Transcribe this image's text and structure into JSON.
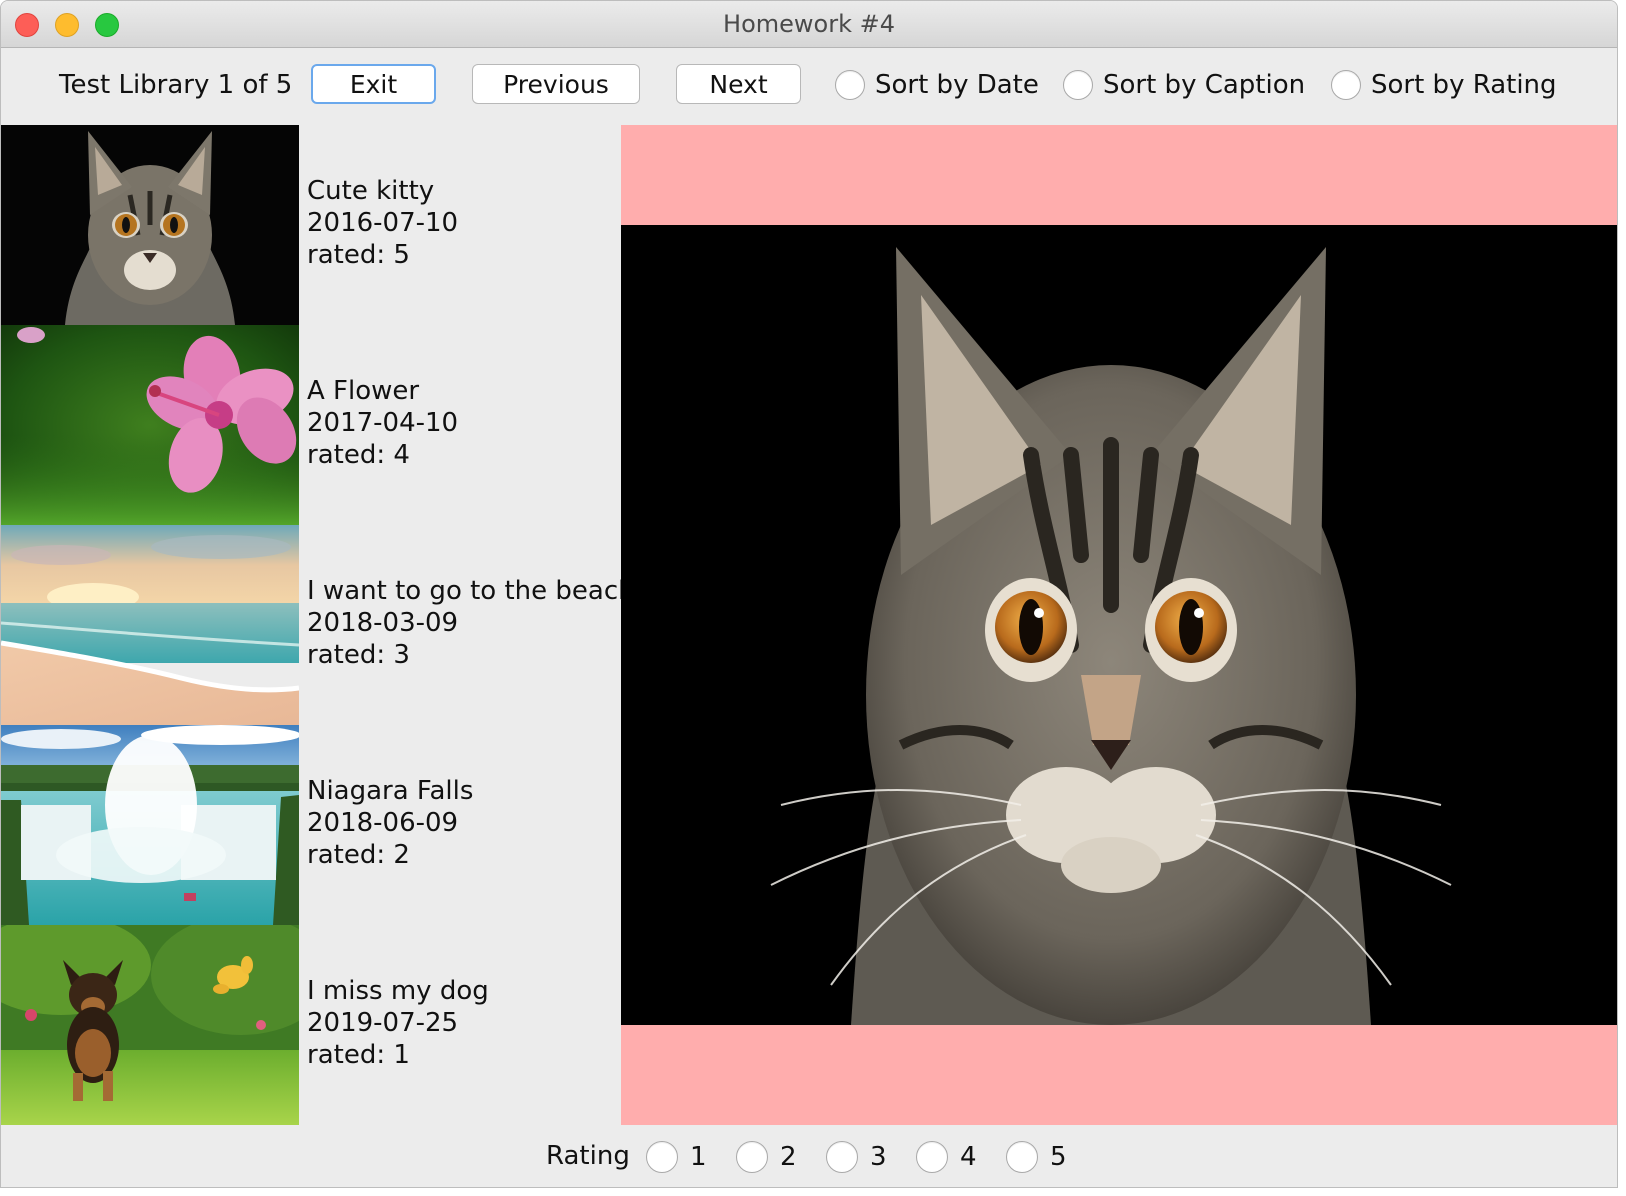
{
  "window": {
    "title": "Homework #4"
  },
  "toolbar": {
    "library_label": "Test Library 1 of 5",
    "exit_label": "Exit",
    "previous_label": "Previous",
    "next_label": "Next",
    "sort_options": [
      "Sort by Date",
      "Sort by Caption",
      "Sort by Rating"
    ]
  },
  "photos": [
    {
      "caption": "Cute kitty",
      "date": "2016-07-10",
      "rating_text": "rated: 5",
      "thumb_icon": "kitten-photo"
    },
    {
      "caption": "A Flower",
      "date": "2017-04-10",
      "rating_text": "rated: 4",
      "thumb_icon": "hibiscus-photo"
    },
    {
      "caption": "I want to go to the beach",
      "date": "2018-03-09",
      "rating_text": "rated: 3",
      "thumb_icon": "beach-photo"
    },
    {
      "caption": "Niagara Falls",
      "date": "2018-06-09",
      "rating_text": "rated: 2",
      "thumb_icon": "waterfall-photo"
    },
    {
      "caption": "I miss my dog",
      "date": "2019-07-25",
      "rating_text": "rated: 1",
      "thumb_icon": "puppy-photo"
    }
  ],
  "viewer": {
    "image_icon": "kitten-photo",
    "background": "#ffadad"
  },
  "rating_bar": {
    "label": "Rating",
    "options": [
      "1",
      "2",
      "3",
      "4",
      "5"
    ]
  },
  "colors": {
    "focus_ring": "#6aa8ec",
    "viewer_bg": "#ffadad",
    "window_bg": "#ececec"
  }
}
